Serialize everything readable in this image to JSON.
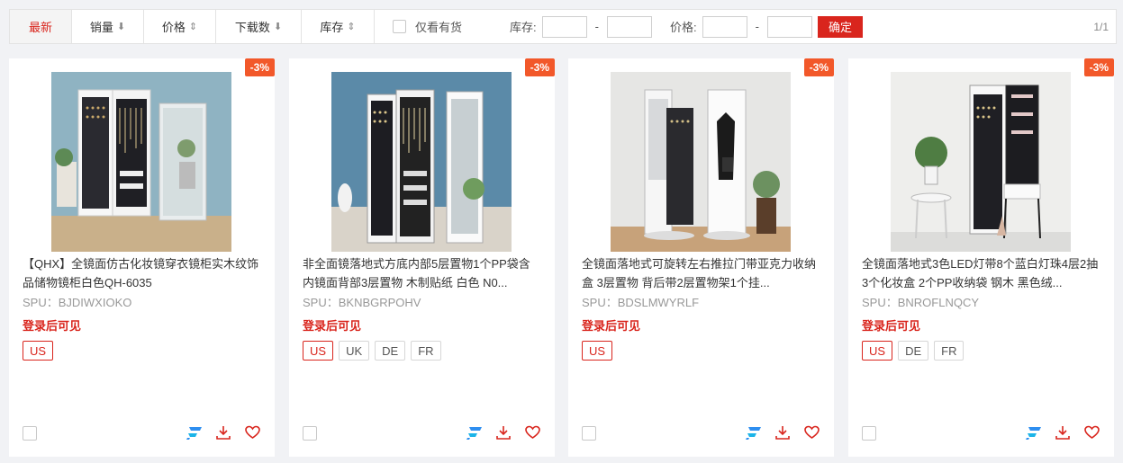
{
  "filter": {
    "sort_tabs": [
      {
        "label": "最新",
        "arrow": ""
      },
      {
        "label": "销量",
        "arrow": "⬇"
      },
      {
        "label": "价格",
        "arrow": "⇕"
      },
      {
        "label": "下载数",
        "arrow": "⬇"
      },
      {
        "label": "库存",
        "arrow": "⇕"
      }
    ],
    "stock_only_label": "仅看有货",
    "stock_label": "库存:",
    "price_label": "价格:",
    "dash": "-",
    "confirm_label": "确定",
    "pager": "1/1"
  },
  "colors": {
    "accent": "#d9251d",
    "badge": "#f2582a"
  },
  "products": [
    {
      "badge": "-3%",
      "title": "【QHX】全镜面仿古化妆镜穿衣镜柜实木纹饰品储物镜柜白色QH-6035",
      "spu": "SPU：BJDIWXIOKO",
      "price": "登录后可见",
      "regions": [
        "US"
      ],
      "image_icon": "wall-mounted-jewelry-mirror-cabinet-image"
    },
    {
      "badge": "-3%",
      "title": "非全面镜落地式方底内部5层置物1个PP袋含内镜面背部3层置物 木制贴纸 白色 N0...",
      "spu": "SPU：BKNBGRPOHV",
      "price": "登录后可见",
      "regions": [
        "US",
        "UK",
        "DE",
        "FR"
      ],
      "image_icon": "standing-jewelry-mirror-cabinet-image"
    },
    {
      "badge": "-3%",
      "title": "全镜面落地式可旋转左右推拉门带亚克力收纳盒 3层置物 背后带2层置物架1个挂...",
      "spu": "SPU：BDSLMWYRLF",
      "price": "登录后可见",
      "regions": [
        "US"
      ],
      "image_icon": "rotating-mirror-cabinet-image"
    },
    {
      "badge": "-3%",
      "title": "全镜面落地式3色LED灯带8个蓝白灯珠4层2抽3个化妆盒 2个PP收纳袋 钢木 黑色绒...",
      "spu": "SPU：BNROFLNQCY",
      "price": "登录后可见",
      "regions": [
        "US",
        "DE",
        "FR"
      ],
      "image_icon": "led-mirror-cabinet-image"
    }
  ]
}
